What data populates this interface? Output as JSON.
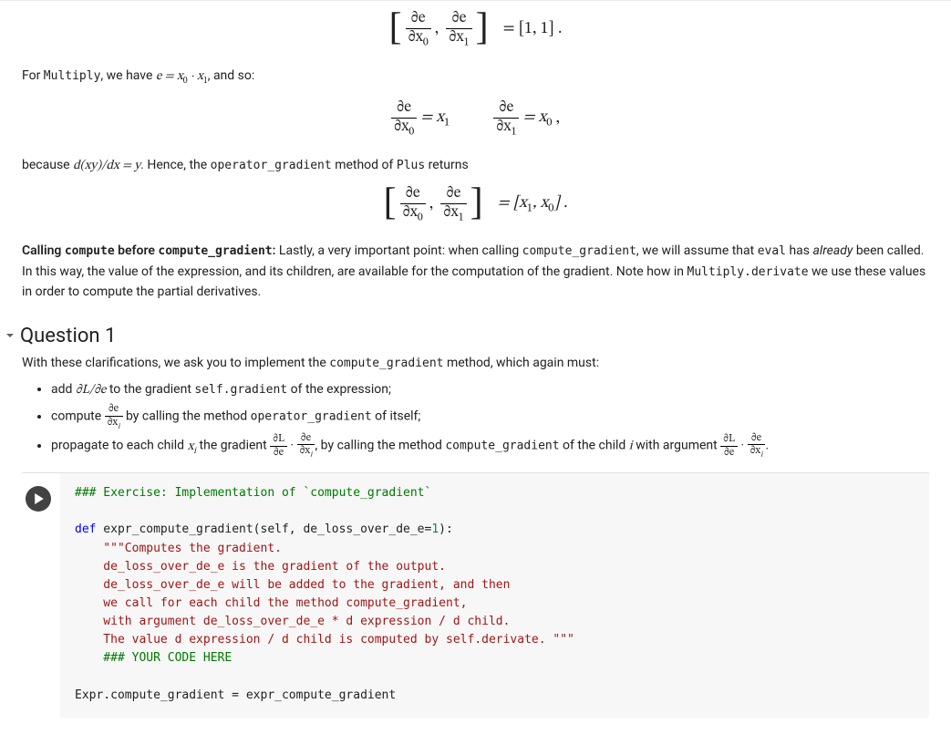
{
  "eq1": {
    "lhs_frac1_num": "∂e",
    "lhs_frac1_den": "∂x",
    "lhs_frac2_num": "∂e",
    "lhs_frac2_den": "∂x",
    "rhs": "= [1, 1] ."
  },
  "para1": {
    "pre": "For ",
    "code": "Multiply",
    "mid": ", we have ",
    "math": "e = x",
    "math_sub0": "0",
    "math_mid": " · x",
    "math_sub1": "1",
    "post": ", and so:"
  },
  "eq2": {
    "f1_num": "∂e",
    "f1_den": "∂x",
    "f1_sub": "0",
    "eq1": " = x",
    "eq1_sub": "1",
    "f2_num": "∂e",
    "f2_den": "∂x",
    "f2_sub": "1",
    "eq2": " = x",
    "eq2_sub": "0",
    "tail": " ,"
  },
  "para2": {
    "pre": "because ",
    "math": "d(xy)/dx = y",
    "post": ". Hence, the ",
    "code1": "operator_gradient",
    "mid": " method of ",
    "code2": "Plus",
    "end": " returns"
  },
  "eq3": {
    "rhs_pre": "= [x",
    "s1": "1",
    "mid": ", x",
    "s0": "0",
    "post": "] ."
  },
  "para3": {
    "b": "Calling ",
    "bc1": "compute",
    "bmid": " before ",
    "bc2": "compute_gradient",
    "bcolon": ":",
    "t1": " Lastly, a very important point: when calling ",
    "c1": "compute_gradient",
    "t2": ", we will assume that ",
    "c2": "eval",
    "t3": " has ",
    "it": "already",
    "t4": " been called. In this way, the value of the expression, and its children, are available for the computation of the gradient. Note how in ",
    "c3": "Multiply.derivate",
    "t5": " we use these values in order to compute the partial derivatives."
  },
  "q_header": "Question 1",
  "q_intro": {
    "pre": "With these clarifications, we ask you to implement the ",
    "c": "compute_gradient",
    "post": " method, which again must:"
  },
  "bullets": {
    "b1_pre": "add ",
    "b1_math": "∂L/∂e",
    "b1_mid": " to the gradient ",
    "b1_code": "self.gradient",
    "b1_post": " of the expression;",
    "b2_pre": "compute ",
    "b2_num": "∂e",
    "b2_den": "∂x",
    "b2_den_sub": "i",
    "b2_mid": " by calling the method ",
    "b2_code": "operator_gradient",
    "b2_post": " of itself;",
    "b3_pre": "propagate to each child ",
    "b3_xi": "x",
    "b3_xi_sub": "i",
    "b3_mid": " the gradient ",
    "b3_f1n": "∂L",
    "b3_f1d": "∂e",
    "b3_dot": " · ",
    "b3_f2n": "∂e",
    "b3_f2d": "∂x",
    "b3_f2d_sub": "i",
    "b3_t2": ", by calling the method ",
    "b3_code": "compute_gradient",
    "b3_t3": " of the child ",
    "b3_i": "i",
    "b3_t4": " with argument ",
    "b3_period": "."
  },
  "code": {
    "l1": "### Exercise: Implementation of `compute_gradient`",
    "l3_def": "def",
    "l3_rest": " expr_compute_gradient(self, de_loss_over_de_e=",
    "l3_num": "1",
    "l3_end": "):",
    "l4": "    \"\"\"Computes the gradient.",
    "l5": "    de_loss_over_de_e is the gradient of the output.",
    "l6": "    de_loss_over_de_e will be added to the gradient, and then",
    "l7": "    we call for each child the method compute_gradient,",
    "l8": "    with argument de_loss_over_de_e * d expression / d child.",
    "l9": "    The value d expression / d child is computed by self.derivate. \"\"\"",
    "l10": "    ### YOUR CODE HERE",
    "l12": "Expr.compute_gradient = expr_compute_gradient"
  }
}
